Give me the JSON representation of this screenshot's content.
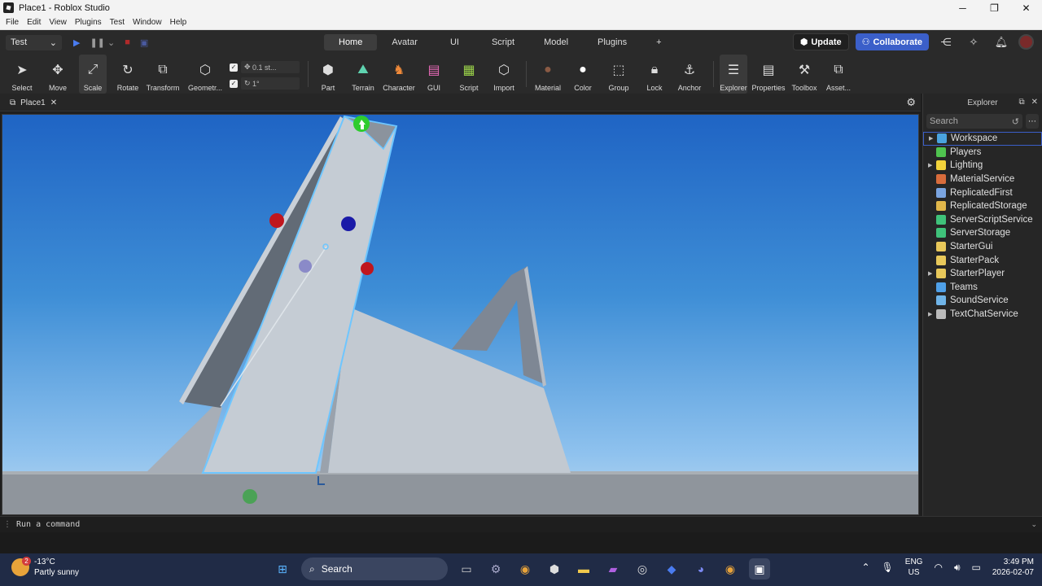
{
  "window": {
    "title": "Place1 - Roblox Studio",
    "controls": [
      "─",
      "❐",
      "✕"
    ]
  },
  "menu": [
    "File",
    "Edit",
    "View",
    "Plugins",
    "Test",
    "Window",
    "Help"
  ],
  "topbar": {
    "mode": "Test",
    "tabs": [
      "Home",
      "Avatar",
      "UI",
      "Script",
      "Model",
      "Plugins",
      "+"
    ],
    "active_tab": "Home",
    "update_label": "Update",
    "collaborate_label": "Collaborate"
  },
  "ribbon": {
    "tools": [
      "Select",
      "Move",
      "Scale",
      "Rotate",
      "Transform",
      "Geometr..."
    ],
    "snap_move": "0.1 st...",
    "snap_rotate": "1°",
    "insert": [
      "Part",
      "Terrain",
      "Character",
      "GUI",
      "Script",
      "Import"
    ],
    "edit": [
      "Material",
      "Color",
      "Group",
      "Lock",
      "Anchor"
    ],
    "panels": [
      "Explorer",
      "Properties",
      "Toolbox",
      "Asset..."
    ]
  },
  "document": {
    "tab": "Place1"
  },
  "command": {
    "placeholder": "Run a command"
  },
  "explorer": {
    "title": "Explorer",
    "search_placeholder": "Search",
    "items": [
      {
        "label": "Workspace",
        "expandable": true,
        "color": "#4aa3df"
      },
      {
        "label": "Players",
        "expandable": false,
        "color": "#4fc34f"
      },
      {
        "label": "Lighting",
        "expandable": true,
        "color": "#f2d33b"
      },
      {
        "label": "MaterialService",
        "expandable": false,
        "color": "#d86c3c"
      },
      {
        "label": "ReplicatedFirst",
        "expandable": false,
        "color": "#7aa4e0"
      },
      {
        "label": "ReplicatedStorage",
        "expandable": false,
        "color": "#e0b64a"
      },
      {
        "label": "ServerScriptService",
        "expandable": false,
        "color": "#3fc27a"
      },
      {
        "label": "ServerStorage",
        "expandable": false,
        "color": "#3fc27a"
      },
      {
        "label": "StarterGui",
        "expandable": false,
        "color": "#e8c85a"
      },
      {
        "label": "StarterPack",
        "expandable": false,
        "color": "#e8c85a"
      },
      {
        "label": "StarterPlayer",
        "expandable": true,
        "color": "#e8c85a"
      },
      {
        "label": "Teams",
        "expandable": false,
        "color": "#4fa0e8"
      },
      {
        "label": "SoundService",
        "expandable": false,
        "color": "#6fb4e8"
      },
      {
        "label": "TextChatService",
        "expandable": true,
        "color": "#bbbbbb"
      }
    ],
    "selected": "Workspace"
  },
  "taskbar": {
    "weather_temp": "-13°C",
    "weather_desc": "Partly sunny",
    "weather_badge": "2",
    "search_label": "Search",
    "lang_top": "ENG",
    "lang_bottom": "US",
    "time": "3:49 PM",
    "date": "2026-02-07"
  }
}
